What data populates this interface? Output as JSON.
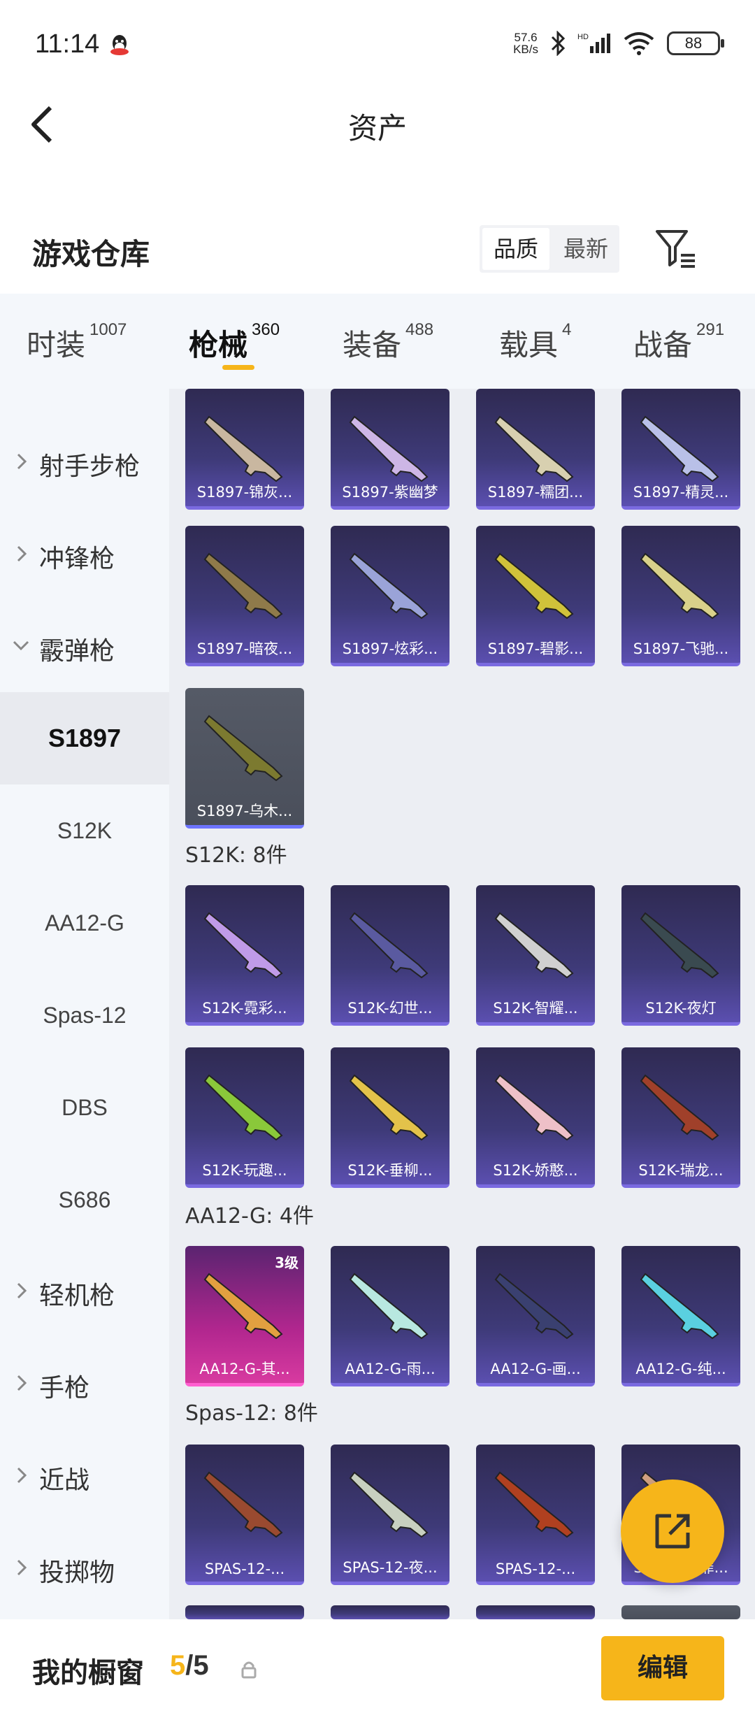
{
  "status_bar": {
    "time": "11:14",
    "net_speed_top": "57.6",
    "net_speed_bottom": "KB/s",
    "battery": "88",
    "icons": [
      "qq-icon",
      "bluetooth-icon",
      "signal-icon",
      "wifi-icon",
      "battery-icon"
    ]
  },
  "header": {
    "title": "资产"
  },
  "warehouse": {
    "title": "游戏仓库",
    "sort_quality": "品质",
    "sort_newest": "最新"
  },
  "tabs": [
    {
      "label": "时装",
      "count": "1007"
    },
    {
      "label": "枪械",
      "count": "360"
    },
    {
      "label": "装备",
      "count": "488"
    },
    {
      "label": "载具",
      "count": "4"
    },
    {
      "label": "战备",
      "count": "291"
    }
  ],
  "sidebar": {
    "categories": [
      "射手步枪",
      "冲锋枪",
      "霰弹枪",
      "轻机枪",
      "手枪",
      "近战",
      "投掷物"
    ],
    "subs": [
      "S1897",
      "S12K",
      "AA12-G",
      "Spas-12",
      "DBS",
      "S686"
    ]
  },
  "sections": [
    {
      "title": ""
    },
    {
      "title": "S12K: 8件"
    },
    {
      "title": "AA12-G: 4件"
    },
    {
      "title": "Spas-12: 8件"
    }
  ],
  "cards": {
    "s1897": [
      "S1897-锦灰...",
      "S1897-紫幽梦",
      "S1897-糯团...",
      "S1897-精灵...",
      "S1897-暗夜...",
      "S1897-炫彩...",
      "S1897-碧影...",
      "S1897-飞驰...",
      "S1897-乌木..."
    ],
    "s12k": [
      "S12K-霓彩...",
      "S12K-幻世...",
      "S12K-智耀...",
      "S12K-夜灯",
      "S12K-玩趣...",
      "S12K-垂柳...",
      "S12K-娇憨...",
      "S12K-瑞龙..."
    ],
    "aa12": [
      "AA12-G-其...",
      "AA12-G-雨...",
      "AA12-G-画...",
      "AA12-G-纯..."
    ],
    "aa12_level": "3级",
    "spas": [
      "SPAS-12-...",
      "SPAS-12-夜...",
      "SPAS-12-...",
      "SPAS-12-罪..."
    ]
  },
  "bottom_bar": {
    "title": "我的橱窗",
    "current": "5",
    "separator": "/",
    "total": "5",
    "edit": "编辑"
  },
  "colors": {
    "accent": "#f6b51a",
    "card_purple": "#3e3a78",
    "card_pink": "#b0268e",
    "card_grey": "#4a4f5b"
  }
}
